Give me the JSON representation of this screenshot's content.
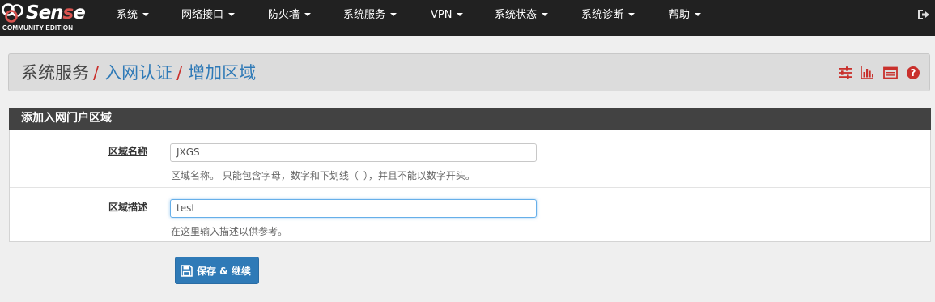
{
  "brand": {
    "logo_text_pre": "pf",
    "logo_text_main": "Sen",
    "logo_text_red": "s",
    "logo_text_end": "e",
    "edition": "COMMUNITY EDITION"
  },
  "nav": {
    "items": [
      {
        "label": "系统"
      },
      {
        "label": "网络接口"
      },
      {
        "label": "防火墙"
      },
      {
        "label": "系统服务"
      },
      {
        "label": "VPN"
      },
      {
        "label": "系统状态"
      },
      {
        "label": "系统诊断"
      },
      {
        "label": "帮助"
      }
    ],
    "logout_icon": "sign-out-icon"
  },
  "breadcrumb": {
    "root": "系统服务",
    "sep": "/",
    "level1": "入网认证",
    "level2": "增加区域"
  },
  "toolbar_icons": [
    "sliders-icon",
    "bar-chart-icon",
    "table-icon",
    "help-circle-icon"
  ],
  "form": {
    "heading": "添加入网门户区域",
    "zone_name": {
      "label": "区域名称",
      "value": "JXGS",
      "help": "区域名称。 只能包含字母，数字和下划线（_），并且不能以数字开头。"
    },
    "zone_desc": {
      "label": "区域描述",
      "value": "test",
      "help": "在这里输入描述以供参考。"
    }
  },
  "save_button": {
    "label": "保存 & 继续",
    "icon": "save-icon"
  },
  "colors": {
    "navbar_bg": "#212121",
    "accent_red": "#c9302c",
    "link_blue": "#2f7ab7",
    "panel_heading_bg": "#424242"
  }
}
